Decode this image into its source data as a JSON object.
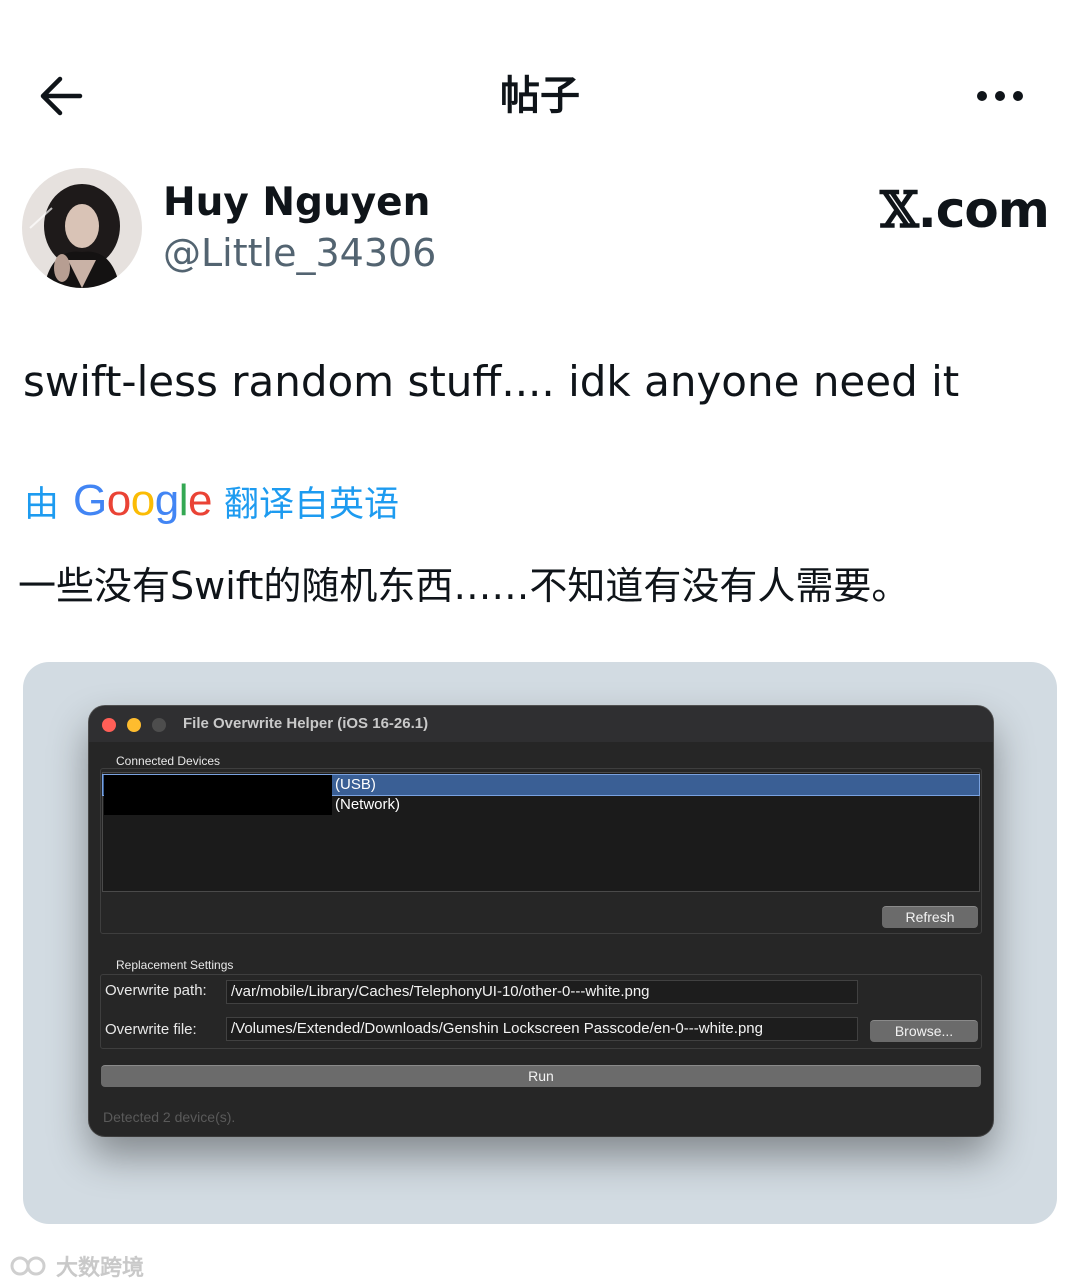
{
  "header": {
    "title": "帖子"
  },
  "author": {
    "display_name": "Huy Nguyen",
    "handle": "@Little_34306",
    "source_brand": ".com",
    "source_brand_mark": "𝕏"
  },
  "post": {
    "text": "swift-less random stuff.... idk anyone need it",
    "translate_by": "由",
    "translate_brand": [
      "G",
      "o",
      "o",
      "g",
      "l",
      "e"
    ],
    "translate_suffix": "翻译自英语",
    "translated_text": "一些没有Swift的随机东西……不知道有没有人需要。"
  },
  "app_window": {
    "title": "File Overwrite Helper (iOS 16-26.1)",
    "connected_devices_label": "Connected Devices",
    "devices": [
      {
        "label": "(USB)",
        "selected": true
      },
      {
        "label": "(Network)",
        "selected": false
      }
    ],
    "refresh_label": "Refresh",
    "replacement_settings_label": "Replacement Settings",
    "overwrite_path_label": "Overwrite path:",
    "overwrite_path_value": "/var/mobile/Library/Caches/TelephonyUI-10/other-0---white.png",
    "overwrite_file_label": "Overwrite file:",
    "overwrite_file_value": "/Volumes/Extended/Downloads/Genshin Lockscreen Passcode/en-0---white.png",
    "browse_label": "Browse...",
    "run_label": "Run",
    "status_text": "Detected 2 device(s)."
  },
  "watermark": {
    "text": "大数跨境"
  },
  "colors": {
    "accent_link": "#1d9bf0",
    "handle_gray": "#536471",
    "media_bg": "#d2dbe2",
    "window_bg": "#262626",
    "selection_blue": "#3a5f95",
    "light_red": "#ff5f57",
    "light_yellow": "#febc2e",
    "light_gray": "#4d4d4d"
  }
}
